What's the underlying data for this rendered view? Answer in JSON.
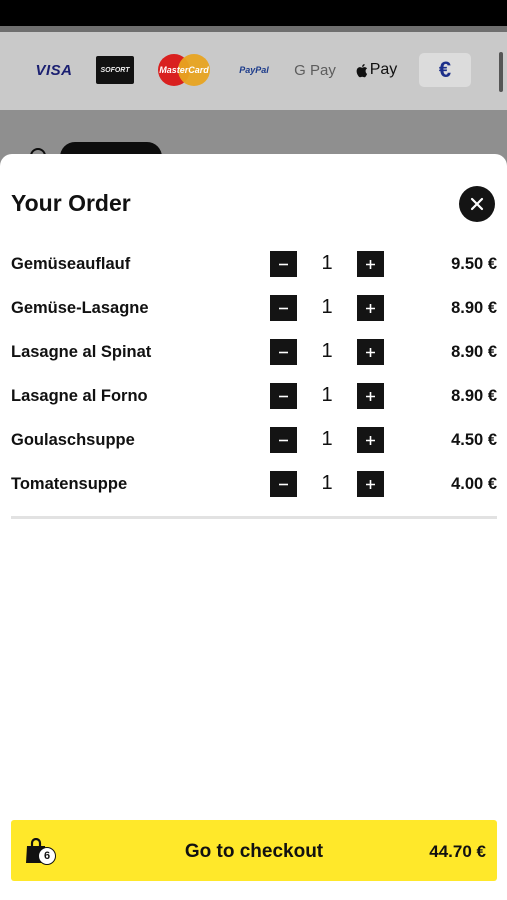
{
  "payment_methods": {
    "visa": "VISA",
    "sofort": "SOFORT",
    "mastercard": "MasterCard",
    "paypal": "PayPal",
    "gpay": "G Pay",
    "applepay": "Pay",
    "currency": "€"
  },
  "order": {
    "title": "Your Order",
    "items": [
      {
        "name": "Gemüseauflauf",
        "qty": "1",
        "price": "9.50 €"
      },
      {
        "name": "Gemüse-Lasagne",
        "qty": "1",
        "price": "8.90 €"
      },
      {
        "name": "Lasagne al Spinat",
        "qty": "1",
        "price": "8.90 €"
      },
      {
        "name": "Lasagne al Forno",
        "qty": "1",
        "price": "8.90 €"
      },
      {
        "name": "Goulaschsuppe",
        "qty": "1",
        "price": "4.50 €"
      },
      {
        "name": "Tomatensuppe",
        "qty": "1",
        "price": "4.00 €"
      }
    ]
  },
  "checkout": {
    "label": "Go to checkout",
    "total": "44.70 €",
    "item_count": "6"
  },
  "icons": {
    "close": "close-icon",
    "minus": "minus-icon",
    "plus": "plus-icon",
    "bag": "shopping-bag-icon"
  },
  "colors": {
    "accent": "#ffe82a",
    "dark": "#141414"
  }
}
